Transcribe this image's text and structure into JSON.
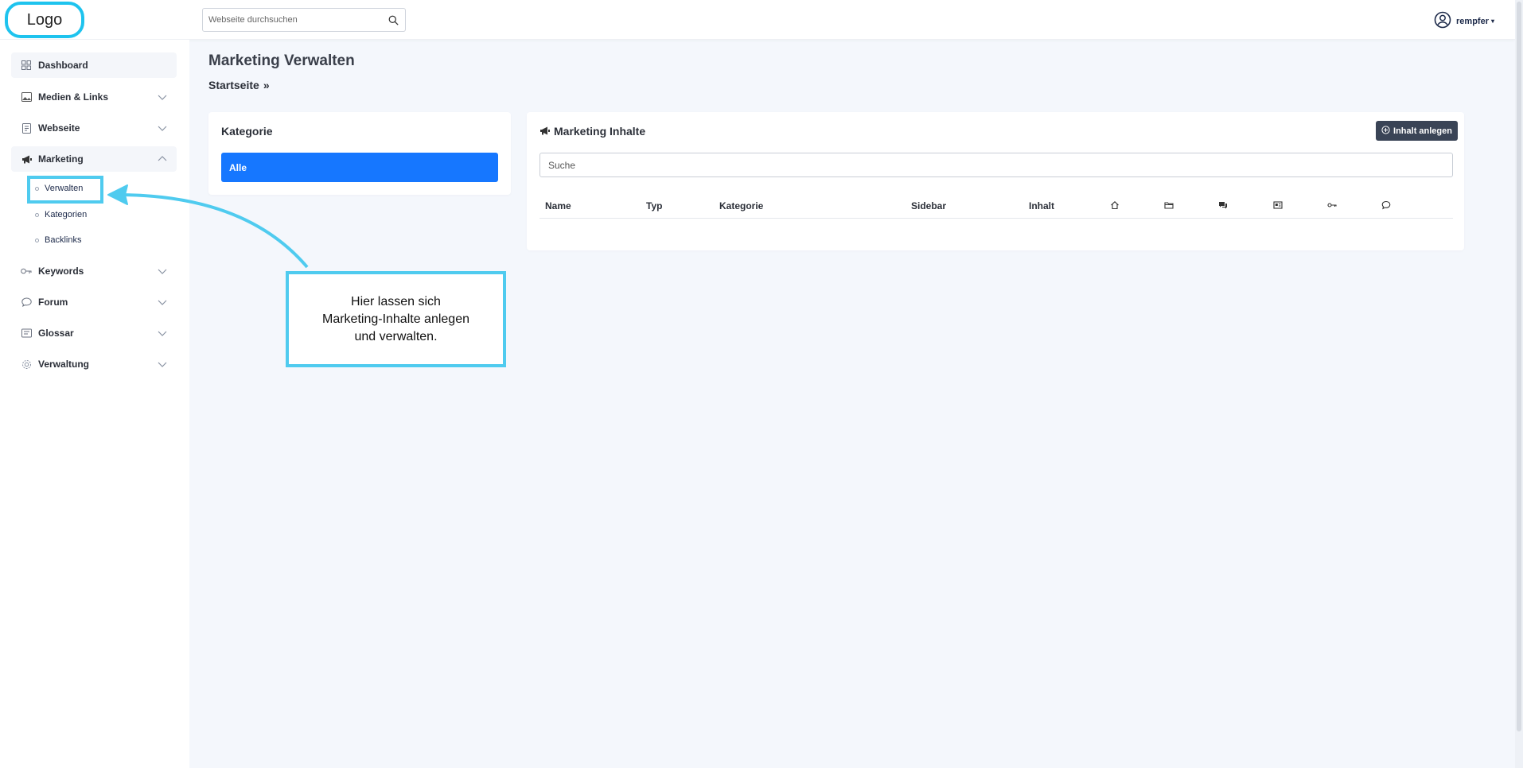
{
  "header": {
    "logo": "Logo",
    "search_placeholder": "Webseite durchsuchen",
    "user_name": "rempfer"
  },
  "sidebar": {
    "items": [
      {
        "label": "Dashboard",
        "icon": "grid-icon"
      },
      {
        "label": "Medien & Links",
        "icon": "image-icon"
      },
      {
        "label": "Webseite",
        "icon": "page-icon"
      },
      {
        "label": "Marketing",
        "icon": "megaphone-icon"
      },
      {
        "label": "Keywords",
        "icon": "key-icon"
      },
      {
        "label": "Forum",
        "icon": "chat-bubble-icon"
      },
      {
        "label": "Glossar",
        "icon": "book-icon"
      },
      {
        "label": "Verwaltung",
        "icon": "cog-icon"
      }
    ],
    "marketing_subitems": [
      {
        "label": "Verwalten"
      },
      {
        "label": "Kategorien"
      },
      {
        "label": "Backlinks"
      }
    ]
  },
  "main": {
    "page_title": "Marketing Verwalten",
    "breadcrumb": {
      "home": "Startseite",
      "separator": "»"
    },
    "category_card": {
      "title": "Kategorie",
      "selected_category": "Alle",
      "selected_color": "#1677ff"
    },
    "marketing_card": {
      "title": "Marketing Inhalte",
      "add_button": "Inhalt anlegen",
      "search_placeholder": "Suche",
      "columns": [
        "Name",
        "Typ",
        "Kategorie",
        "Sidebar",
        "Inhalt"
      ],
      "icon_columns": [
        "home-icon",
        "folder-icon",
        "comments-icon",
        "card-icon",
        "key-icon",
        "comment-icon"
      ]
    }
  },
  "annotation": {
    "text_lines": [
      "Hier lassen sich",
      "Marketing-Inhalte anlegen",
      "und verwalten."
    ],
    "accent_color": "#4fcbef"
  }
}
